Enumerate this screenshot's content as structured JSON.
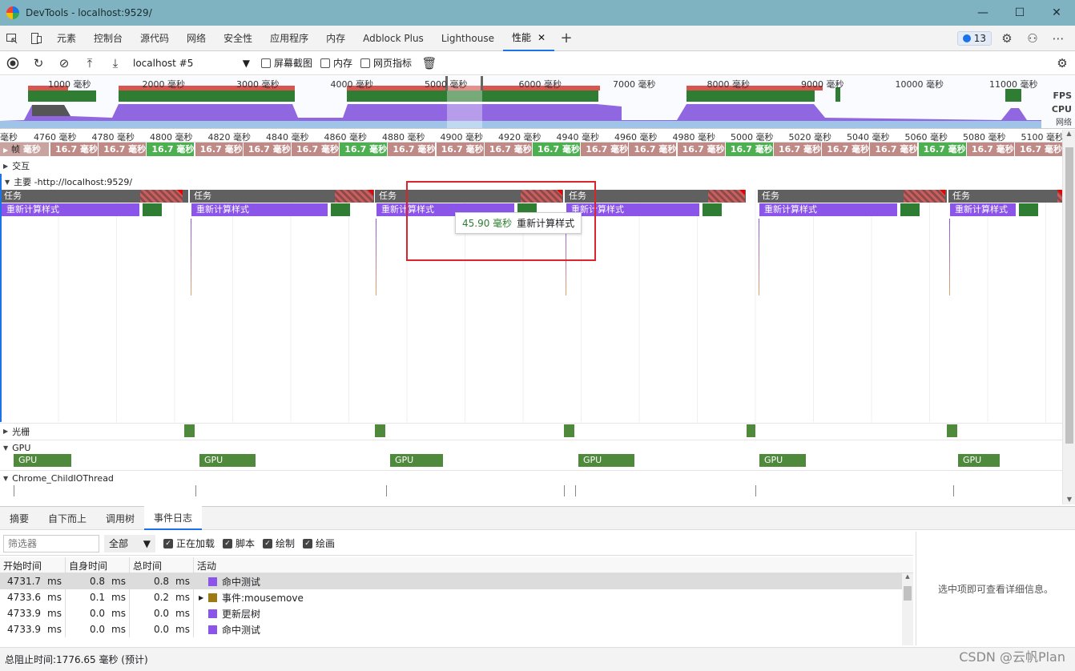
{
  "window": {
    "title": "DevTools - localhost:9529/"
  },
  "tabs": [
    {
      "label": "元素"
    },
    {
      "label": "控制台"
    },
    {
      "label": "源代码"
    },
    {
      "label": "网络"
    },
    {
      "label": "安全性"
    },
    {
      "label": "应用程序"
    },
    {
      "label": "内存"
    },
    {
      "label": "Adblock Plus"
    },
    {
      "label": "Lighthouse"
    },
    {
      "label": "性能",
      "active": true
    }
  ],
  "issues_count": "13",
  "toolbar": {
    "profile": "localhost #5",
    "screenshots_label": "屏幕截图",
    "memory_label": "内存",
    "web_vitals_label": "网页指标"
  },
  "overview": {
    "ticks": [
      "1000 毫秒",
      "2000 毫秒",
      "3000 毫秒",
      "4000 毫秒",
      "5000 毫秒",
      "6000 毫秒",
      "7000 毫秒",
      "8000 毫秒",
      "9000 毫秒",
      "10000 毫秒",
      "11000 毫秒"
    ],
    "fps_label": "FPS",
    "cpu_label": "CPU",
    "net_label": "网络"
  },
  "ruler": [
    "毫秒",
    "4760 毫秒",
    "4780 毫秒",
    "4800 毫秒",
    "4820 毫秒",
    "4840 毫秒",
    "4860 毫秒",
    "4880 毫秒",
    "4900 毫秒",
    "4920 毫秒",
    "4940 毫秒",
    "4960 毫秒",
    "4980 毫秒",
    "5000 毫秒",
    "5020 毫秒",
    "5040 毫秒",
    "5060 毫秒",
    "5080 毫秒",
    "5100 毫秒"
  ],
  "frames": {
    "label": "帧",
    "first": "毫秒",
    "value": "16.7 毫秒",
    "pattern": [
      "red",
      "red",
      "green",
      "red",
      "red",
      "red",
      "green",
      "red",
      "red",
      "red",
      "green",
      "red",
      "red",
      "red",
      "green",
      "red",
      "red",
      "red",
      "green",
      "red",
      "red"
    ]
  },
  "tracks": {
    "interactions": "交互",
    "main": "主要 -http://localhost:9529/",
    "raster": "光栅",
    "gpu": "GPU",
    "io": "Chrome_ChildIOThread"
  },
  "flame": {
    "task_label": "任务",
    "recalc_label": "重新计算样式",
    "gpu_label": "GPU"
  },
  "tooltip": {
    "duration": "45.90 毫秒",
    "name": "重新计算样式"
  },
  "bottom_tabs": [
    {
      "label": "摘要"
    },
    {
      "label": "自下而上"
    },
    {
      "label": "调用树"
    },
    {
      "label": "事件日志",
      "active": true
    }
  ],
  "filter": {
    "placeholder": "筛选器",
    "select_value": "全部",
    "loading_label": "正在加载",
    "script_label": "脚本",
    "render_label": "绘制",
    "paint_label": "绘画"
  },
  "table": {
    "headers": [
      "开始时间",
      "自身时间",
      "总时间",
      "活动"
    ],
    "rows": [
      {
        "start": "4731.7",
        "self": "0.8",
        "total": "0.8",
        "activity": "命中测试",
        "color": "#8b55ea",
        "expand": false,
        "selected": true
      },
      {
        "start": "4733.6",
        "self": "0.1",
        "total": "0.2",
        "activity": "事件:mousemove",
        "color": "#9c7a14",
        "expand": true,
        "selected": false
      },
      {
        "start": "4733.9",
        "self": "0.0",
        "total": "0.0",
        "activity": "更新层树",
        "color": "#8b55ea",
        "expand": false,
        "selected": false
      },
      {
        "start": "4733.9",
        "self": "0.0",
        "total": "0.0",
        "activity": "命中测试",
        "color": "#8b55ea",
        "expand": false,
        "selected": false
      }
    ],
    "unit": "ms"
  },
  "details_hint": "选中项即可查看详细信息。",
  "status": "总阻止时间:1776.65 毫秒 (预计)",
  "watermark": "CSDN @云帆Plan"
}
